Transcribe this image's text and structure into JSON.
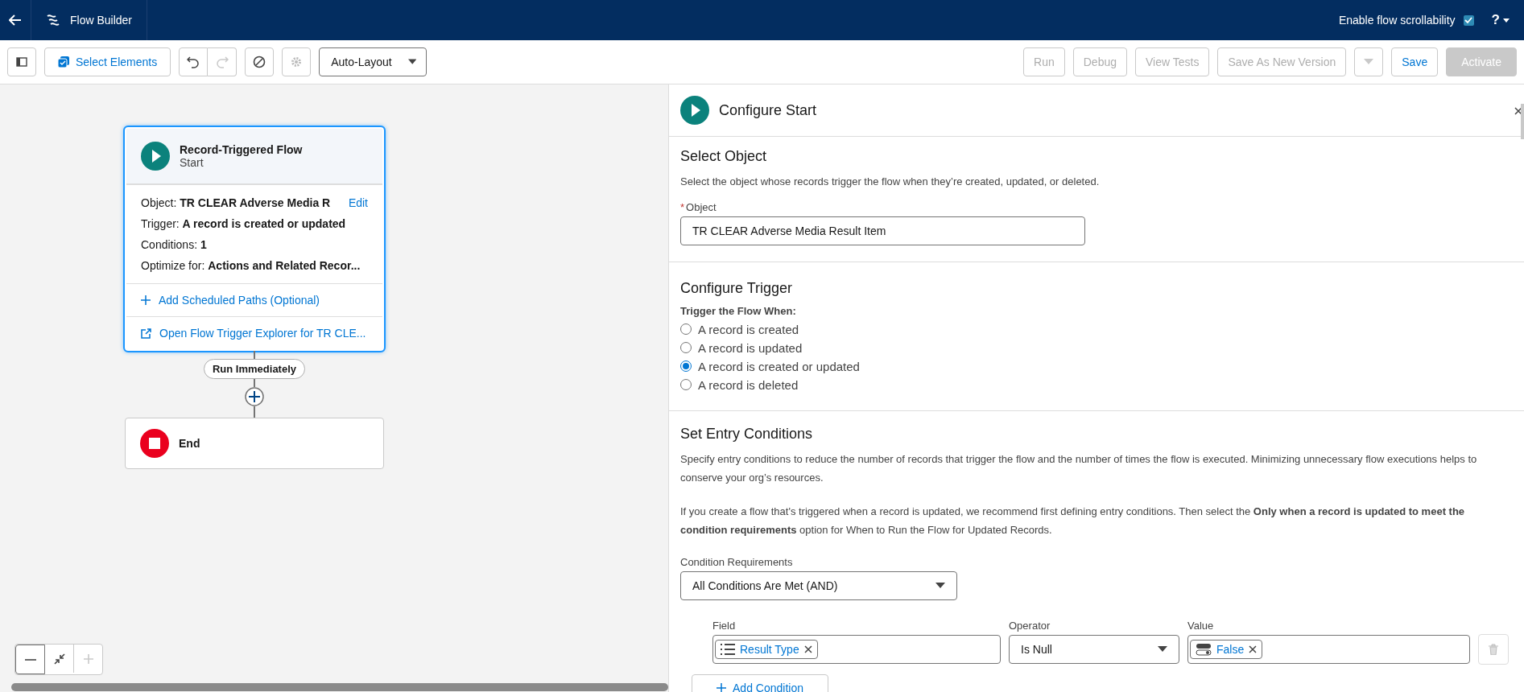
{
  "header": {
    "title": "Flow Builder",
    "scroll_label": "Enable flow scrollability",
    "scroll_checked": true,
    "help": "?"
  },
  "toolbar": {
    "select_elements": "Select Elements",
    "undo_disabled": false,
    "redo_disabled": true,
    "gear_disabled": true,
    "layout": "Auto-Layout",
    "actions": [
      {
        "kind": "button",
        "label": "Run",
        "disabled": true
      },
      {
        "kind": "button",
        "label": "Debug",
        "disabled": true
      },
      {
        "kind": "button",
        "label": "View Tests",
        "disabled": true
      },
      {
        "kind": "button",
        "label": "Save As New Version",
        "disabled": true
      },
      {
        "kind": "menu",
        "disabled": true
      },
      {
        "kind": "button",
        "label": "Save",
        "disabled": false
      },
      {
        "kind": "primary",
        "label": "Activate",
        "disabled": true
      }
    ]
  },
  "canvas": {
    "start_node": {
      "title": "Record-Triggered Flow",
      "subtitle": "Start",
      "selected": true,
      "details": [
        "Object: **TR CLEAR Adverse Media R**",
        "Trigger:  **A record is created or updated**",
        "Conditions: **1**",
        "Optimize for: **Actions and Related Recor...**"
      ],
      "edit": "Edit",
      "add_paths": "Add Scheduled Paths (Optional)",
      "explorer": "Open Flow Trigger Explorer for TR CLE..."
    },
    "connector_label": "Run Immediately",
    "end_node": {
      "title": "End"
    },
    "zoom_controls": [
      {
        "kind": "zoom-out",
        "disabled": false
      },
      {
        "kind": "fit",
        "disabled": false
      },
      {
        "kind": "zoom-in",
        "disabled": true
      }
    ]
  },
  "panel": {
    "title": "Configure Start",
    "select_object": {
      "heading": "Select Object",
      "description": "Select the object whose records trigger the flow when they’re created, updated, or deleted.",
      "label": "Object",
      "required_mark": "*",
      "value": "TR CLEAR Adverse Media Result Item"
    },
    "configure_trigger": {
      "heading": "Configure Trigger",
      "label": "Trigger the Flow When:",
      "options": [
        {
          "label": "A record is created",
          "selected": false
        },
        {
          "label": "A record is updated",
          "selected": false
        },
        {
          "label": "A record is created or updated",
          "selected": true
        },
        {
          "label": "A record is deleted",
          "selected": false
        }
      ]
    },
    "entry_conditions": {
      "heading": "Set Entry Conditions",
      "paragraphs": [
        "Specify entry conditions to reduce the number of records that trigger the flow and the number of times the flow is executed. Minimizing unnecessary flow executions helps to conserve your org’s resources.",
        "If you create a flow that's triggered when a record is updated, we recommend first defining entry conditions. Then select the **Only when a record is updated to meet the condition requirements** option for When to Run the Flow for Updated Records."
      ],
      "requirements_label": "Condition Requirements",
      "requirements_value": "All Conditions Are Met (AND)",
      "columns": [
        "Field",
        "Operator",
        "Value"
      ],
      "conditions": [
        {
          "field": "Result Type",
          "operator": "Is Null",
          "value": "False"
        }
      ],
      "add_condition": "Add Condition"
    }
  }
}
